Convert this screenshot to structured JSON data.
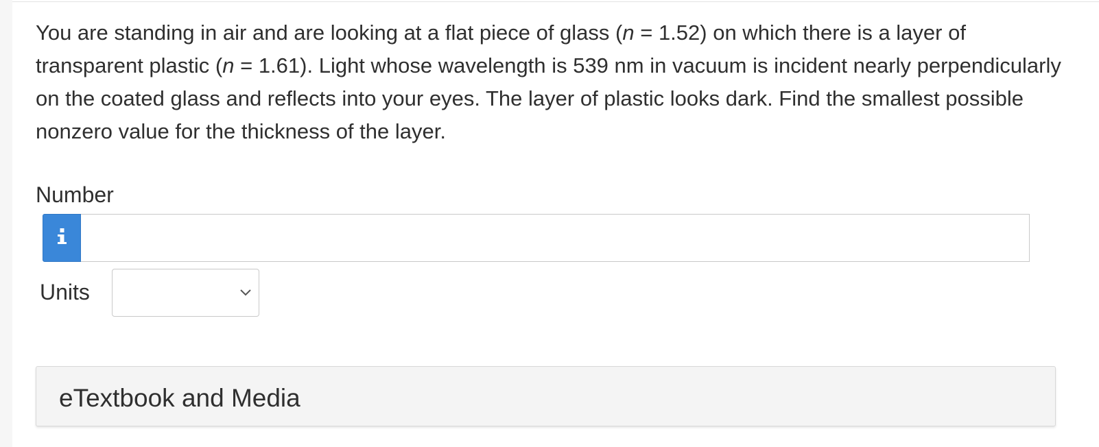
{
  "question": {
    "part1": "You are standing in air and are looking at a flat piece of glass (",
    "var1": "n",
    "part2": " = 1.52) on which there is a layer of transparent plastic (",
    "var2": "n",
    "part3": " = 1.61). Light whose wavelength is 539 nm in vacuum is incident nearly perpendicularly on the coated glass and reflects into your eyes. The layer of plastic looks dark. Find the smallest possible nonzero value for the thickness of the layer."
  },
  "answer": {
    "number_label": "Number",
    "info_icon": "i",
    "number_value": "",
    "units_label": "Units",
    "units_value": ""
  },
  "media": {
    "title": "eTextbook and Media"
  },
  "colors": {
    "info_button": "#3a87d9",
    "panel_background": "#f4f4f4"
  },
  "icons": {
    "info": "info-icon",
    "dropdown": "chevron-down-icon"
  }
}
